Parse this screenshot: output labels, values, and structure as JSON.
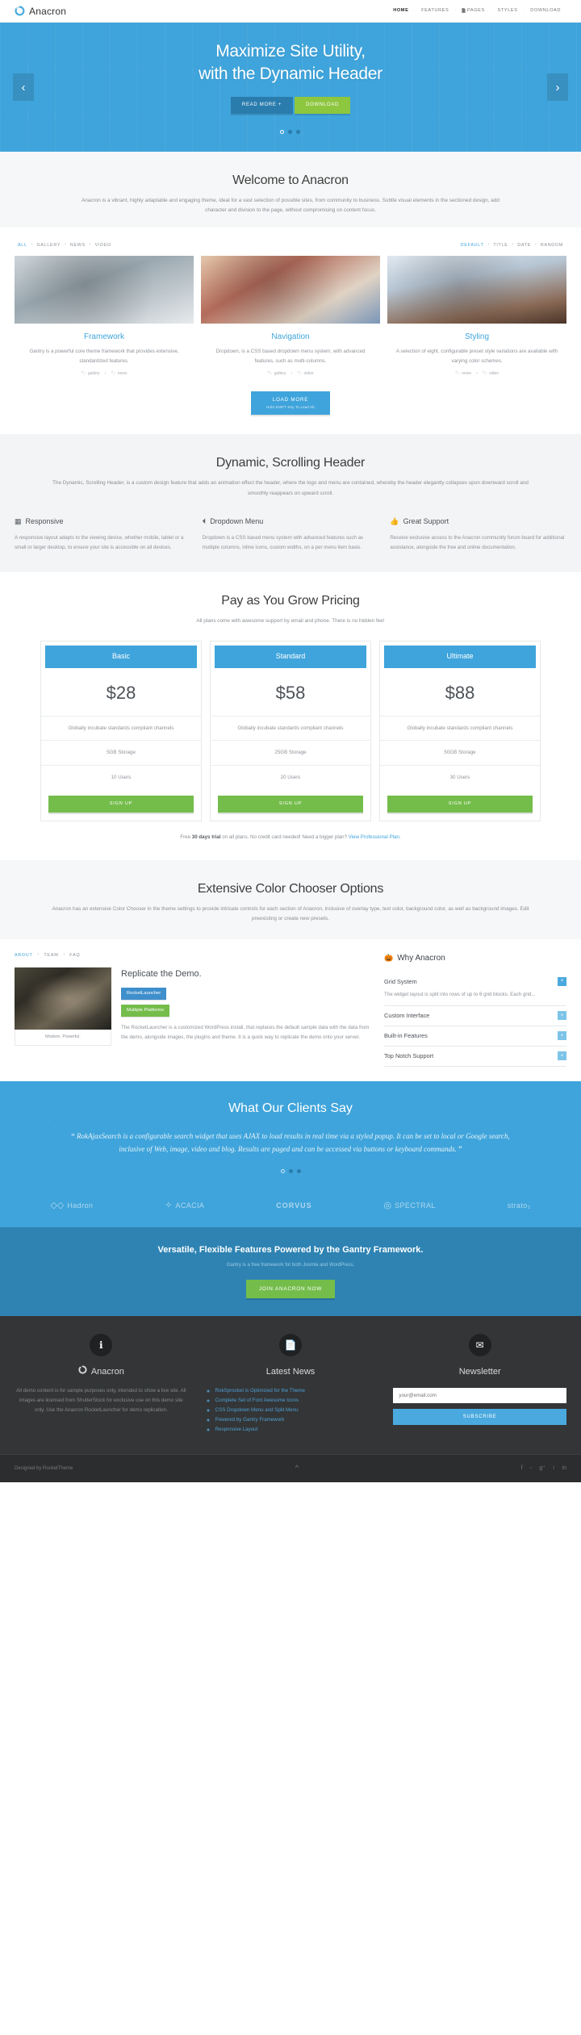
{
  "header": {
    "brand": "Anacron",
    "logo_icon": "circular-spinner-logo",
    "nav": [
      {
        "label": "HOME",
        "active": true,
        "icon": ""
      },
      {
        "label": "FEATURES",
        "active": false,
        "icon": ""
      },
      {
        "label": "PAGES",
        "active": false,
        "icon": "page-icon"
      },
      {
        "label": "STYLES",
        "active": false,
        "icon": ""
      },
      {
        "label": "DOWNLOAD",
        "active": false,
        "icon": ""
      }
    ],
    "separator": "·"
  },
  "hero": {
    "title_line1": "Maximize Site Utility,",
    "title_line2": "with the Dynamic Header",
    "btn_readmore": "READ MORE +",
    "btn_download": "DOWNLOAD",
    "prev_icon": "chevron-left-icon",
    "next_icon": "chevron-right-icon",
    "slides": 3,
    "active_slide": 1,
    "bg_color": "#3fa4db",
    "accent_green": "#8dc63f"
  },
  "welcome": {
    "title": "Welcome to Anacron",
    "subtitle": "Anacron is a vibrant, highly adaptable and engaging theme, ideal for a vast selection of possible sites, from community to business. Subtle visual elements in the sectioned design, add character and division to the page, without compromising on content focus."
  },
  "portfolio": {
    "filters_left": [
      "ALL",
      "GALLERY",
      "NEWS",
      "VIDEO"
    ],
    "filters_left_active": "ALL",
    "filters_right": [
      "DEFAULT",
      "TITLE",
      "DATE",
      "RANDOM"
    ],
    "filters_right_active": "DEFAULT",
    "items": [
      {
        "title": "Framework",
        "desc": "Gantry is a powerful core theme framework that provides extensive, standardized features.",
        "tags": [
          "gallery",
          "news"
        ]
      },
      {
        "title": "Navigation",
        "desc": "Dropdown, is a CSS based dropdown menu system, with advanced features, such as multi-columns.",
        "tags": [
          "gallery",
          "video"
        ]
      },
      {
        "title": "Styling",
        "desc": "A selection of eight, configurable preset style variations are available with varying color schemes.",
        "tags": [
          "news",
          "video"
        ]
      }
    ],
    "load_more": "LOAD MORE",
    "load_more_sub": "Hold SHIFT Key To Load All"
  },
  "scrolling_header": {
    "title": "Dynamic, Scrolling Header",
    "subtitle": "The Dynamic, Scrolling Header, is a custom design feature that adds an animation effect the header, where the logo and menu are contained, whereby the header elegantly collapses upon downward scroll and smoothly reappears on upward scroll.",
    "features": [
      {
        "icon": "grid-icon",
        "title": "Responsive",
        "body": "A responsive layout adapts to the viewing device, whether mobile, tablet or a small or larger desktop, to ensure your site is accessible on all devices."
      },
      {
        "icon": "bar-chart-icon",
        "title": "Dropdown Menu",
        "body": "Dropdown is a CSS based menu system with advanced features such as multiple columns, inline icons, custom widths, on a per menu item basis."
      },
      {
        "icon": "thumbs-up-icon",
        "title": "Great Support",
        "body": "Receive exclusive access to the Anacron community forum board for additional assistance, alongside the free and online documentation."
      }
    ]
  },
  "pricing": {
    "title": "Pay as You Grow Pricing",
    "subtitle": "All plans come with awesome support by email and phone. There is no hidden fee!",
    "plans": [
      {
        "name": "Basic",
        "price": "$28",
        "feature": "Globally incubate standards compliant channels",
        "storage": "5GB Storage",
        "users": "10 Users",
        "cta": "SIGN UP"
      },
      {
        "name": "Standard",
        "price": "$58",
        "feature": "Globally incubate standards compliant channels",
        "storage": "25GB Storage",
        "users": "20 Users",
        "cta": "SIGN UP"
      },
      {
        "name": "Ultimate",
        "price": "$88",
        "feature": "Globally incubate standards compliant channels",
        "storage": "50GB Storage",
        "users": "30 Users",
        "cta": "SIGN UP"
      }
    ],
    "note_pre": "Free ",
    "note_bold": "30 days trial",
    "note_mid": " on all plans. No credit card needed! Need a bigger plan? ",
    "note_link": "View Professional Plan."
  },
  "color_chooser": {
    "title": "Extensive Color Chooser Options",
    "subtitle": "Anacron has an extensive Color Chooser in the theme settings to provide intricate controls for each section of Anacron, inclusive of overlay type, text color, background color, as well as background images. Edit preexisting or create new presets."
  },
  "demo": {
    "tabs": [
      "ABOUT",
      "TEAM",
      "FAQ"
    ],
    "active_tab": "ABOUT",
    "image_caption": "Modern. Powerful.",
    "title": "Replicate the Demo.",
    "badge_blue": "RocketLauncher",
    "badge_green": "Multiple Platforms",
    "body": "The RocketLauncher is a customized WordPress install, that replaces the default sample data with the data from the demo, alongside images, the plugins and theme. It is a quick way to replicate the demo onto your server."
  },
  "why": {
    "icon": "puzzle-icon",
    "title": "Why Anacron",
    "items": [
      {
        "label": "Grid System",
        "open": true,
        "toggle": "×",
        "body": "The widget layout is split into rows of up to 6 grid blocks. Each grid..."
      },
      {
        "label": "Custom Interface",
        "open": false,
        "toggle": "+",
        "body": ""
      },
      {
        "label": "Built-in Features",
        "open": false,
        "toggle": "+",
        "body": ""
      },
      {
        "label": "Top Notch Support",
        "open": false,
        "toggle": "+",
        "body": ""
      }
    ]
  },
  "testimonials": {
    "title": "What Our Clients Say",
    "quote": "RokAjaxSearch is a configurable search widget that uses AJAX to load results in real time via a styled popup. It can be set to local or Google search, inclusive of Web, image, video and blog. Results are paged and can be accessed via buttons or keyboard commands.",
    "open_quote": "“",
    "close_quote": "”",
    "slides": 3,
    "active_slide": 1
  },
  "logos": [
    {
      "mark": "◇◇",
      "text": "Hadron",
      "bold": false
    },
    {
      "mark": "✧",
      "text": "ACACIA",
      "bold": false
    },
    {
      "mark": "",
      "text": "CORVUS",
      "bold": true
    },
    {
      "mark": "◎",
      "text": "SPECTRAL",
      "bold": false
    },
    {
      "mark": "",
      "text": "strato₂",
      "bold": false
    }
  ],
  "cta": {
    "title": "Versatile, Flexible Features Powered by the Gantry Framework.",
    "subtitle": "Gantry is a free framework for both Joomla and WordPress.",
    "button": "JOIN ANACRON NOW"
  },
  "footer": {
    "columns": [
      {
        "icon": "info-circle-icon",
        "heading": "Anacron",
        "heading_icon": "circular-spinner-logo",
        "text": "All demo content is for sample purposes only, intended to show a live site. All images are licensed from ShutterStock for exclusive use on this demo site only. Use the Anacron RocketLauncher for demo replication."
      },
      {
        "icon": "document-icon",
        "heading": "Latest News",
        "links": [
          "RokSprocket is Optimized for the Theme",
          "Complete Set of Font Awesome Icons",
          "CSS Dropdown Menu and Split Menu",
          "Powered by Gantry Framework",
          "Responsive Layout"
        ]
      },
      {
        "icon": "envelope-icon",
        "heading": "Newsletter",
        "input_placeholder": "your@email.com",
        "input_value": "",
        "button": "SUBSCRIBE"
      }
    ],
    "copyright": "Designed by RocketTheme",
    "scroll_top_icon": "chevron-up-icon",
    "socials": [
      "facebook-icon",
      "twitter-icon",
      "google-plus-icon",
      "rss-icon",
      "linkedin-icon"
    ],
    "social_glyphs": [
      "f",
      "ᵕ",
      "g⁺",
      "≀",
      "in"
    ]
  }
}
